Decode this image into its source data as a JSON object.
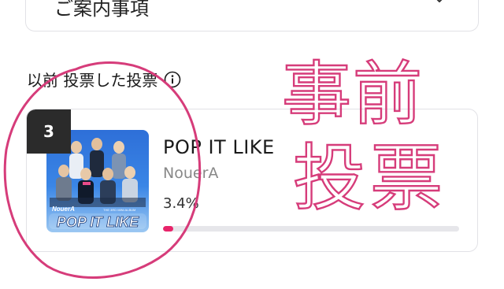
{
  "top_card": {
    "label": "ご案内事項",
    "chevron_icon": "chevron-down-icon"
  },
  "section": {
    "title": "以前 投票した投票",
    "info_icon": "info-icon"
  },
  "vote_item": {
    "rank": "3",
    "title": "POP IT LIKE",
    "artist": "NouerA",
    "percent_label": "3.4%",
    "progress": 0.034,
    "accent_color": "#e8246a",
    "album_cover": {
      "logo_text": "NouerA",
      "subtitle": "THE 3RD MINI ALBUM",
      "album_title": "POP IT LIKE"
    }
  },
  "handwriting": {
    "text": "事前投票",
    "color": "#d63c7a"
  }
}
